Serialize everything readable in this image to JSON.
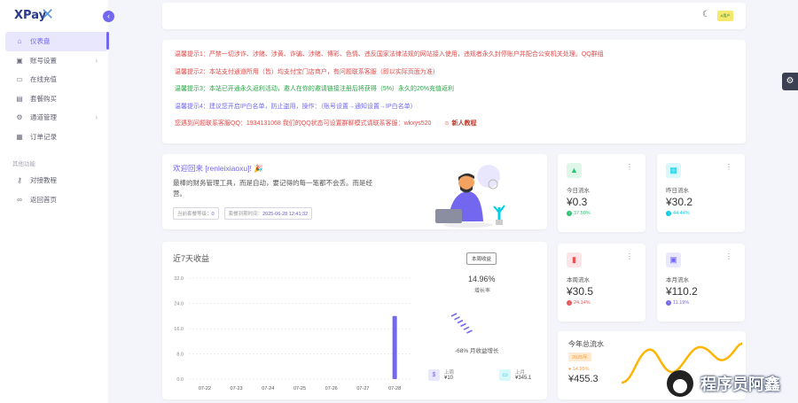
{
  "brand": {
    "logo_text": "XPay"
  },
  "sidebar": {
    "collapse_icon": "chevron-left-icon",
    "items": [
      {
        "label": "仪表盘",
        "icon": "home-icon",
        "active": true
      },
      {
        "label": "账号设置",
        "icon": "user-card-icon",
        "chevron": "›"
      },
      {
        "label": "在线充值",
        "icon": "wallet-icon"
      },
      {
        "label": "套餐购买",
        "icon": "cart-icon"
      },
      {
        "label": "通道管理",
        "icon": "gear-icon",
        "chevron": "›"
      },
      {
        "label": "订单记录",
        "icon": "list-icon"
      }
    ],
    "section_title": "其他功能",
    "extra_items": [
      {
        "label": "对接教程",
        "icon": "key-icon"
      },
      {
        "label": "返回首页",
        "icon": "link-icon"
      }
    ]
  },
  "topbar": {
    "theme_icon": "moon-icon",
    "avatar_text": "A用户"
  },
  "notices": [
    {
      "text": "温馨提示1：严禁一切涉诈、涉赌、涉黄、诈骗、涉赌、博彩、色情、违反国家法律法规的网站接入使用，违规者永久封停账户并配合公安机关处理。QQ群组",
      "color": "#e04b4b"
    },
    {
      "text": "温馨提示2：本站支付通道所用（皆）均支付宝门店商户，有问题联系客服（即以实际页面为准）",
      "color": "#e04b4b"
    },
    {
      "text": "温馨提示3：本站已开通永久返利活动，邀人在你的邀请链接注册后将获得（5%）永久的20%充值返利",
      "color": "#28a745"
    },
    {
      "text": "温馨提示4：建议您开启IP白名单，防止盗用，操作：（账号设置→通知设置→IP白名单）",
      "color": "#7367f0"
    },
    {
      "text": "您遇到问题联系客服QQ：1934131068 我们的QQ状态可设置群聊模式请联系客服：wkxys520",
      "color": "#e04b4b",
      "tutor": "新人教程",
      "tutor_icon": "person-icon"
    }
  ],
  "welcome": {
    "greeting": "欢迎回来 [renleixiaoxu]! 🎉",
    "quote": "最棒的财务管理工具，而是自动，要记得的每一笔都不会丢。而是经营。",
    "chips": [
      {
        "label": "当前套餐等级：",
        "value": "0"
      },
      {
        "label": "套餐到期时间：",
        "value": "2025-06-28 12:41:32"
      }
    ],
    "illustration": "person-laptop-illustration"
  },
  "settings_icon": "gear-icon",
  "stats": [
    {
      "label": "今日流水",
      "value": "¥0.3",
      "pct": "37.50%",
      "icon": "chart-up-icon",
      "color": "#28c76f",
      "bg": "#dff7e9",
      "trend": "up"
    },
    {
      "label": "昨日流水",
      "value": "¥30.2",
      "pct": "44.44%",
      "icon": "calendar-icon",
      "color": "#00cfe8",
      "bg": "#d9f8fc",
      "trend": "up"
    },
    {
      "label": "本周流水",
      "value": "¥30.5",
      "pct": "24.14%",
      "icon": "money-icon",
      "color": "#ea5455",
      "bg": "#fce5e6",
      "trend": "down"
    },
    {
      "label": "本月流水",
      "value": "¥110.2",
      "pct": "11.19%",
      "icon": "box-icon",
      "color": "#7367f0",
      "bg": "#eae8fd",
      "trend": "up"
    }
  ],
  "chart": {
    "title": "近7天收益",
    "button": "本周收益",
    "growth_pct": "14.96%",
    "growth_label": "增长率",
    "monthly_text": "-68% 月收益增长",
    "up_box": {
      "label": "上周",
      "value": "¥10",
      "icon": "dollar-icon"
    },
    "prev_box": {
      "label": "上月",
      "value": "¥345.1",
      "icon": "wallet-icon"
    }
  },
  "chart_data": {
    "type": "bar",
    "categories": [
      "07-22",
      "07-23",
      "07-24",
      "07-25",
      "07-26",
      "07-27",
      "07-28"
    ],
    "values": [
      0,
      0,
      0,
      0,
      0,
      0,
      20
    ],
    "ylim": [
      0,
      32
    ],
    "yticks": [
      "32.0",
      "24.0",
      "16.0",
      "8.0",
      "0.0"
    ],
    "grid": true,
    "bar_color": "#7367f0"
  },
  "annual": {
    "label": "今年总流水",
    "year": "2025年",
    "pct": "14.95%",
    "value": "¥455.3",
    "line_color": "#ffb400"
  },
  "watermark": {
    "text": "程序员阿鑫"
  }
}
